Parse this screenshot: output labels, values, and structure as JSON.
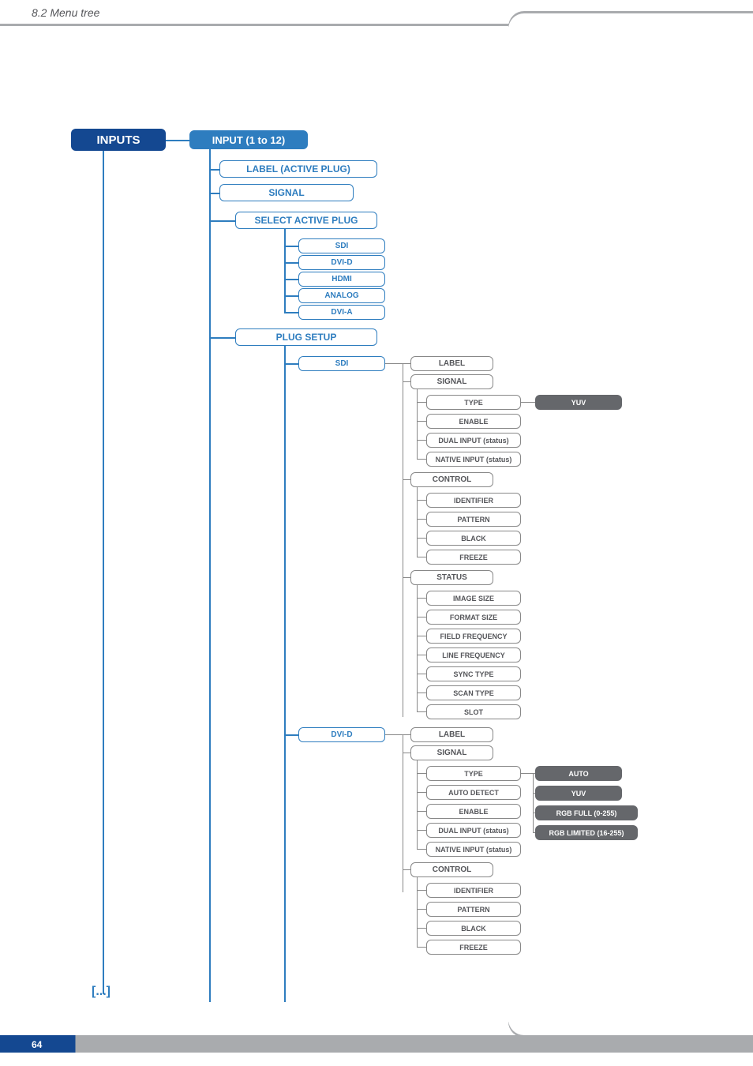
{
  "header": {
    "section": "8.2 Menu tree"
  },
  "pagenum": "64",
  "continuation": "[...]",
  "tree": {
    "root": "INPUTS",
    "input": "INPUT (1 to 12)",
    "label_active": "LABEL (ACTIVE PLUG)",
    "signal": "SIGNAL",
    "select_plug": "SELECT ACTIVE PLUG",
    "plugs": [
      "SDI",
      "DVI-D",
      "HDMI",
      "ANALOG",
      "DVI-A"
    ],
    "plug_setup": "PLUG SETUP",
    "ps_sdi": "SDI",
    "ps_dvid": "DVI-D",
    "sdi": {
      "label": "LABEL",
      "signal": "SIGNAL",
      "type": "TYPE",
      "type_val": "YUV",
      "enable": "ENABLE",
      "dual": "DUAL INPUT (status)",
      "native": "NATIVE INPUT (status)",
      "control": "CONTROL",
      "identifier": "IDENTIFIER",
      "pattern": "PATTERN",
      "black": "BLACK",
      "freeze": "FREEZE",
      "status": "STATUS",
      "image": "IMAGE SIZE",
      "format": "FORMAT SIZE",
      "field": "FIELD FREQUENCY",
      "line": "LINE FREQUENCY",
      "sync": "SYNC TYPE",
      "scan": "SCAN TYPE",
      "slot": "SLOT"
    },
    "dvid": {
      "label": "LABEL",
      "signal": "SIGNAL",
      "type": "TYPE",
      "auto_detect": "AUTO DETECT",
      "enable": "ENABLE",
      "dual": "DUAL INPUT (status)",
      "native": "NATIVE INPUT (status)",
      "type_vals": [
        "AUTO",
        "YUV",
        "RGB FULL (0-255)",
        "RGB LIMITED (16-255)"
      ],
      "control": "CONTROL",
      "identifier": "IDENTIFIER",
      "pattern": "PATTERN",
      "black": "BLACK",
      "freeze": "FREEZE"
    }
  }
}
